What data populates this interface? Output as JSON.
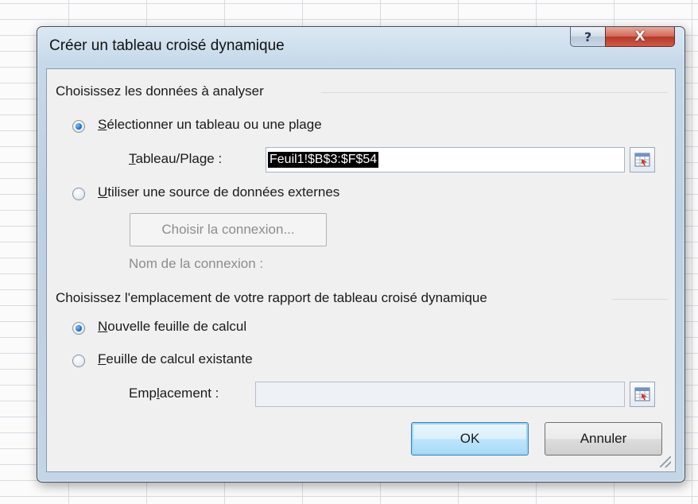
{
  "dialog": {
    "title": "Créer un tableau croisé dynamique",
    "help_glyph": "?",
    "close_glyph": "X"
  },
  "data_section": {
    "heading": "Choisissez les données à analyser",
    "option_range": {
      "accel": "S",
      "rest": "électionner un tableau ou une plage",
      "checked": true
    },
    "range_label": {
      "accel": "T",
      "rest": "ableau/Plage :"
    },
    "range_value": "Feuil1!$B$3:$F$54",
    "option_external": {
      "accel": "U",
      "rest": "tiliser une source de données externes",
      "checked": false
    },
    "choose_connection_button": "Choisir la connexion...",
    "connection_name_label": "Nom de la connexion :"
  },
  "location_section": {
    "heading": "Choisissez l'emplacement de votre rapport de tableau croisé dynamique",
    "option_new_sheet": {
      "accel": "N",
      "rest": "ouvelle feuille de calcul",
      "checked": true
    },
    "option_existing_sheet": {
      "accel": "F",
      "rest": "euille de calcul existante",
      "checked": false
    },
    "location_label": {
      "pre": "Emp",
      "accel": "l",
      "rest": "acement :"
    },
    "location_value": ""
  },
  "buttons": {
    "ok": "OK",
    "cancel": "Annuler"
  },
  "icons": {
    "range_picker": "range-picker-icon"
  }
}
